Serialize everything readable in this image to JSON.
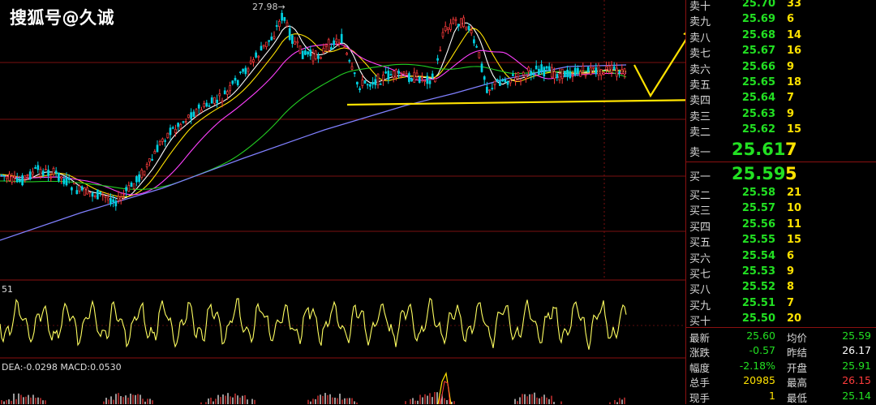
{
  "watermark": "搜狐号@久诚",
  "chart": {
    "peak_label": "27.98",
    "indicator_label": "51",
    "macd_label": "DEA:-0.0298 MACD:0.0530"
  },
  "order_book": {
    "asks": [
      {
        "label": "卖十",
        "price": "25.70",
        "volume": "33"
      },
      {
        "label": "卖九",
        "price": "25.69",
        "volume": "6"
      },
      {
        "label": "卖八",
        "price": "25.68",
        "volume": "14"
      },
      {
        "label": "卖七",
        "price": "25.67",
        "volume": "16"
      },
      {
        "label": "卖六",
        "price": "25.66",
        "volume": "9"
      },
      {
        "label": "卖五",
        "price": "25.65",
        "volume": "18"
      },
      {
        "label": "卖四",
        "price": "25.64",
        "volume": "7"
      },
      {
        "label": "卖三",
        "price": "25.63",
        "volume": "9"
      },
      {
        "label": "卖二",
        "price": "25.62",
        "volume": "15"
      }
    ],
    "ask1": {
      "label": "卖一",
      "price": "25.61",
      "volume": "7"
    },
    "bid1": {
      "label": "买一",
      "price": "25.59",
      "volume": "5"
    },
    "bids": [
      {
        "label": "买二",
        "price": "25.58",
        "volume": "21"
      },
      {
        "label": "买三",
        "price": "25.57",
        "volume": "10"
      },
      {
        "label": "买四",
        "price": "25.56",
        "volume": "11"
      },
      {
        "label": "买五",
        "price": "25.55",
        "volume": "15"
      },
      {
        "label": "买六",
        "price": "25.54",
        "volume": "6"
      },
      {
        "label": "买七",
        "price": "25.53",
        "volume": "9"
      },
      {
        "label": "买八",
        "price": "25.52",
        "volume": "8"
      },
      {
        "label": "买九",
        "price": "25.51",
        "volume": "7"
      },
      {
        "label": "买十",
        "price": "25.50",
        "volume": "20"
      }
    ]
  },
  "stats": [
    {
      "l1": "最新",
      "v1": "25.60",
      "l2": "均价",
      "v2": "25.59"
    },
    {
      "l1": "涨跌",
      "v1": "-0.57",
      "l2": "昨结",
      "v2": "26.17"
    },
    {
      "l1": "幅度",
      "v1": "-2.18%",
      "l2": "开盘",
      "v2": "25.91"
    },
    {
      "l1": "总手",
      "v1": "20985",
      "l2": "最高",
      "v2": "26.15"
    },
    {
      "l1": "现手",
      "v1": "1",
      "l2": "最低",
      "v2": "25.14"
    }
  ],
  "colors": {
    "up": "#ff3c3c",
    "down": "#22e022",
    "accent": "#ffe200",
    "border": "#8a1010"
  }
}
